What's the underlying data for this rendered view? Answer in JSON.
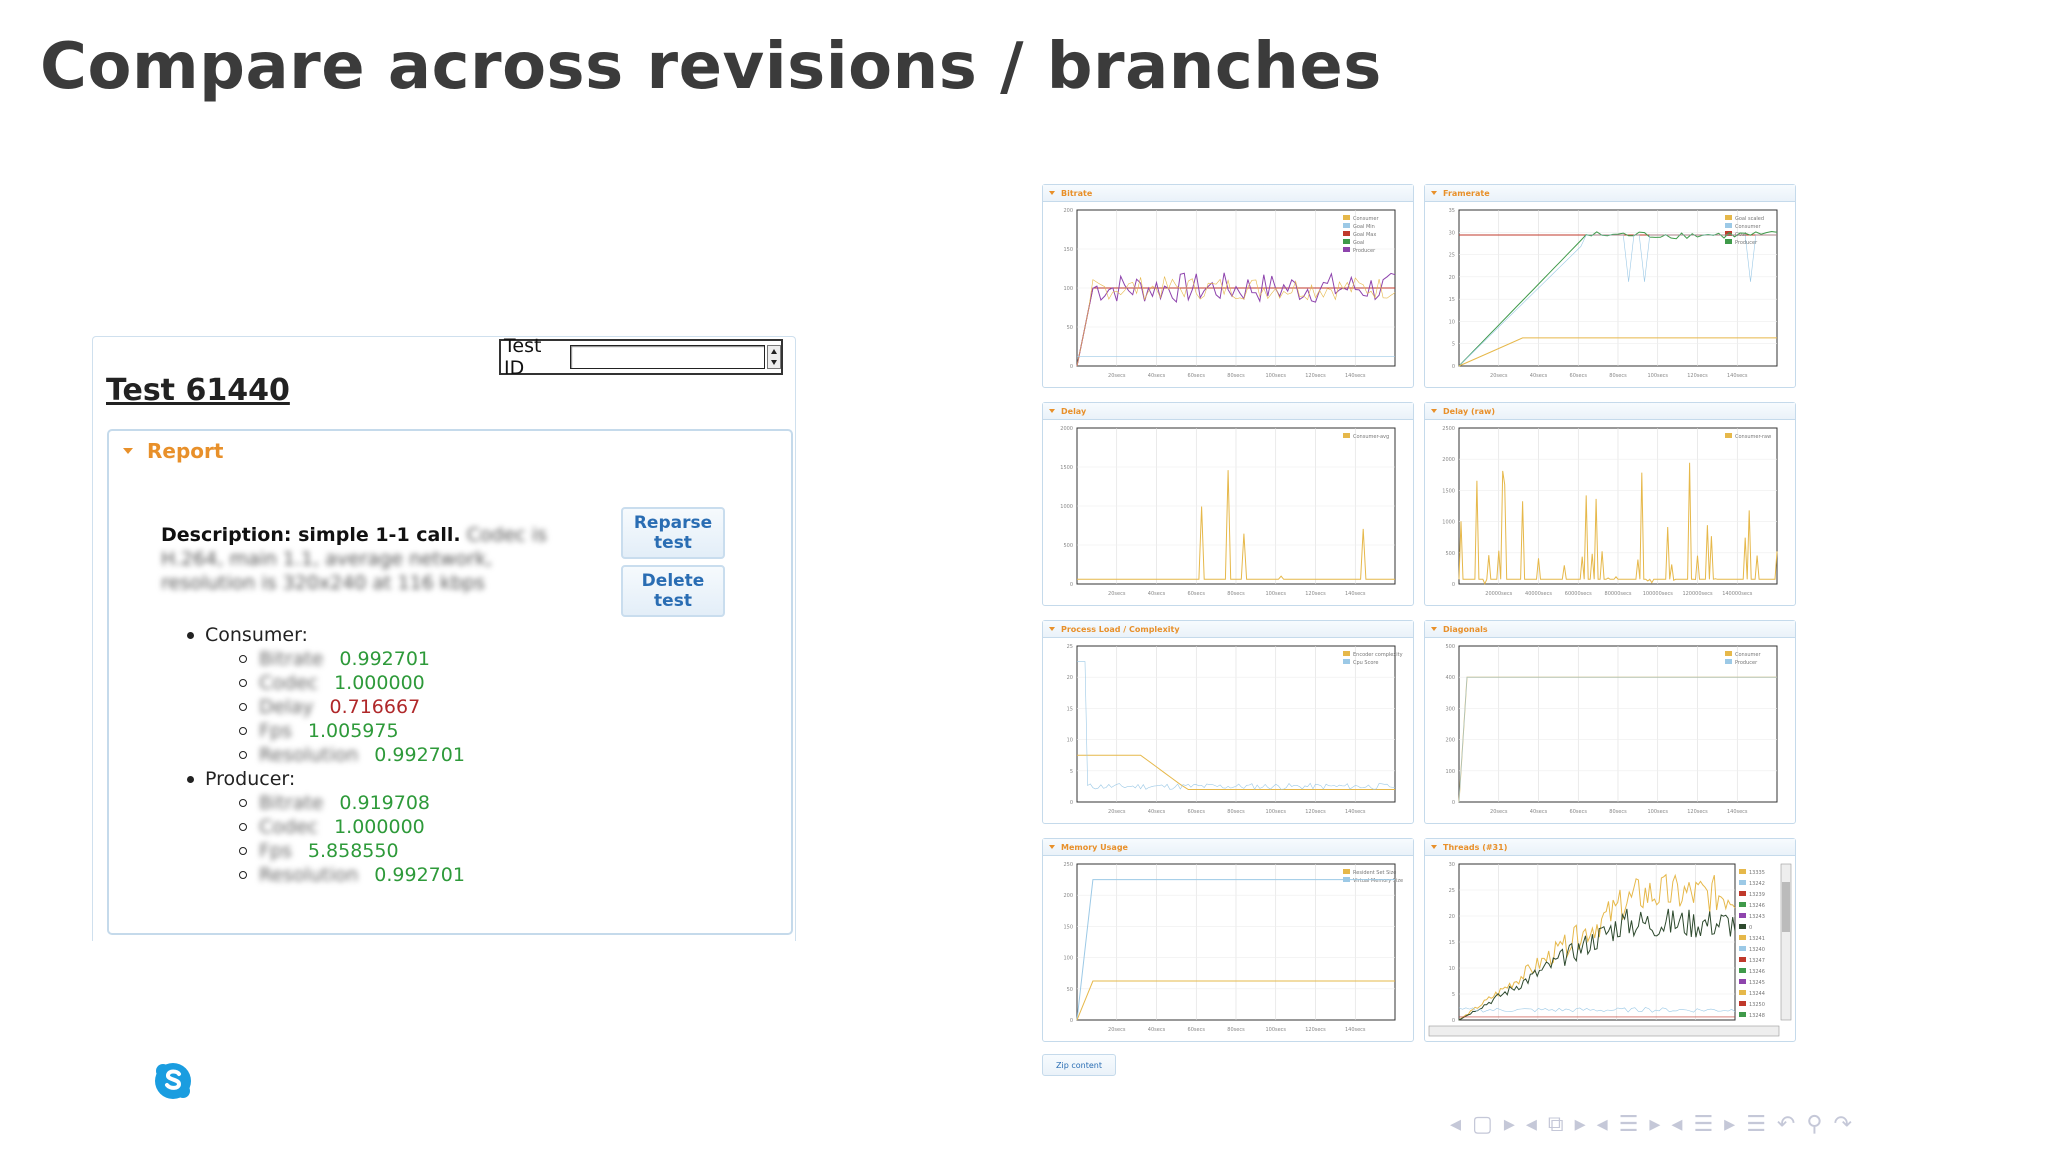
{
  "slide": {
    "title": "Compare across revisions / branches"
  },
  "test_panel": {
    "testid_label": "Test ID",
    "testid_value": "",
    "heading": "Test 61440",
    "report_title": "Report",
    "reparse_label_1": "Reparse",
    "reparse_label_2": "test",
    "delete_label_1": "Delete",
    "delete_label_2": "test",
    "description_label": "Description: simple 1-1 call.",
    "description_blurred": "Codec is H.264, main 1.1, average network, resolution is 320x240 at 116 kbps",
    "consumer_label": "Consumer:",
    "consumer_metrics": [
      {
        "key": "Bitrate",
        "value": "0.992701",
        "status": "good"
      },
      {
        "key": "Codec",
        "value": "1.000000",
        "status": "good"
      },
      {
        "key": "Delay",
        "value": "0.716667",
        "status": "bad"
      },
      {
        "key": "Fps",
        "value": "1.005975",
        "status": "good"
      },
      {
        "key": "Resolution",
        "value": "0.992701",
        "status": "good"
      }
    ],
    "producer_label": "Producer:",
    "producer_metrics": [
      {
        "key": "Bitrate",
        "value": "0.919708",
        "status": "good"
      },
      {
        "key": "Codec",
        "value": "1.000000",
        "status": "good"
      },
      {
        "key": "Fps",
        "value": "5.858550",
        "status": "good"
      },
      {
        "key": "Resolution",
        "value": "0.992701",
        "status": "good"
      }
    ]
  },
  "charts_panel": {
    "zip_label": "Zip content",
    "colors": {
      "yellow": "#e6b84a",
      "lightblue": "#9cc9e6",
      "red": "#c0392b",
      "green": "#3f9a4a",
      "purple": "#8e44ad",
      "darkgreen": "#2e4a2e",
      "accent": "#e8902a"
    }
  },
  "chart_data": [
    {
      "type": "line",
      "title": "Bitrate",
      "x_ticks": [
        "20secs",
        "40secs",
        "60secs",
        "80secs",
        "100secs",
        "120secs",
        "140secs"
      ],
      "y_ticks": [
        "0",
        "50",
        "100",
        "150",
        "200"
      ],
      "ylim": [
        0,
        200
      ],
      "legend": [
        "Consumer",
        "Goal Min",
        "Goal Max",
        "Goal",
        "Producer"
      ],
      "legend_position": "top-right"
    },
    {
      "type": "line",
      "title": "Framerate",
      "x_ticks": [
        "20secs",
        "40secs",
        "60secs",
        "80secs",
        "100secs",
        "120secs",
        "140secs"
      ],
      "y_ticks": [
        "0",
        "5",
        "10",
        "15",
        "20",
        "25",
        "30",
        "35"
      ],
      "ylim": [
        0,
        35
      ],
      "legend": [
        "Goal scaled",
        "Consumer",
        "Goal",
        "Producer"
      ],
      "legend_position": "top-right"
    },
    {
      "type": "line",
      "title": "Delay",
      "x_ticks": [
        "20secs",
        "40secs",
        "60secs",
        "80secs",
        "100secs",
        "120secs",
        "140secs"
      ],
      "y_ticks": [
        "0",
        "500",
        "1000",
        "1500",
        "2000"
      ],
      "ylim": [
        0,
        2000
      ],
      "legend": [
        "Consumer-avg"
      ],
      "legend_position": "top-right"
    },
    {
      "type": "line",
      "title": "Delay (raw)",
      "x_ticks": [
        "20000secs",
        "40000secs",
        "60000secs",
        "80000secs",
        "100000secs",
        "120000secs",
        "140000secs"
      ],
      "y_ticks": [
        "0",
        "500",
        "1000",
        "1500",
        "2000",
        "2500"
      ],
      "ylim": [
        0,
        2500
      ],
      "legend": [
        "Consumer-raw"
      ],
      "legend_position": "top-right"
    },
    {
      "type": "line",
      "title": "Process Load / Complexity",
      "x_ticks": [
        "20secs",
        "40secs",
        "60secs",
        "80secs",
        "100secs",
        "120secs",
        "140secs"
      ],
      "y_ticks": [
        "0",
        "5",
        "10",
        "15",
        "20",
        "25"
      ],
      "ylim": [
        0,
        25
      ],
      "legend": [
        "Encoder complexity",
        "Cpu Score"
      ],
      "legend_position": "top-right"
    },
    {
      "type": "line",
      "title": "Diagonals",
      "x_ticks": [
        "20secs",
        "40secs",
        "60secs",
        "80secs",
        "100secs",
        "120secs",
        "140secs"
      ],
      "y_ticks": [
        "0",
        "100",
        "200",
        "300",
        "400",
        "500"
      ],
      "ylim": [
        0,
        500
      ],
      "legend": [
        "Consumer",
        "Producer"
      ],
      "legend_position": "top-right"
    },
    {
      "type": "line",
      "title": "Memory Usage",
      "x_ticks": [
        "20secs",
        "40secs",
        "60secs",
        "80secs",
        "100secs",
        "120secs",
        "140secs"
      ],
      "y_ticks": [
        "0",
        "50",
        "100",
        "150",
        "200",
        "250"
      ],
      "ylim": [
        0,
        250
      ],
      "legend": [
        "Resident Set Size",
        "Virtual Memory Size"
      ],
      "legend_position": "top-right"
    },
    {
      "type": "line",
      "title": "Threads (#31)",
      "x_ticks": [
        "20secs",
        "40secs",
        "60secs",
        "80secs",
        "100secs",
        "120secs"
      ],
      "y_ticks": [
        "0",
        "5",
        "10",
        "15",
        "20",
        "25",
        "30"
      ],
      "ylim": [
        0,
        30
      ],
      "legend": [
        "13335",
        "13242",
        "13239",
        "13246",
        "13243",
        "0",
        "13241",
        "13240",
        "13247",
        "13246",
        "13245",
        "13244",
        "13250",
        "13248"
      ],
      "legend_position": "top-right"
    }
  ],
  "nav": {
    "symbols": "◂ ▢ ▸  ◂ ⧉ ▸  ◂ ☰ ▸  ◂ ☰ ▸    ☰    ↶ ⚲ ↷"
  }
}
